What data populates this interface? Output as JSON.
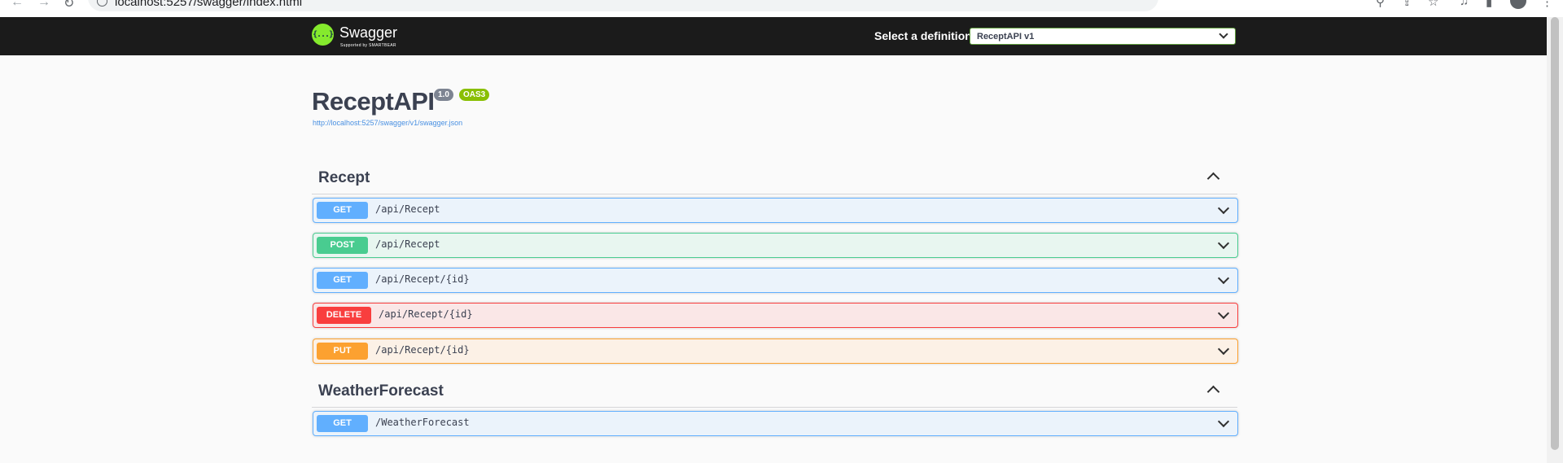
{
  "browser": {
    "url": "localhost:5257/swagger/index.html"
  },
  "topbar": {
    "brand_name": "Swagger",
    "brand_mark": "{...}",
    "brand_sub": "Supported by SMARTBEAR",
    "definition_label": "Select a definition",
    "definition_selected": "ReceptAPI v1"
  },
  "info": {
    "title": "ReceptAPI",
    "version": "1.0",
    "oas": "OAS3",
    "spec_url": "http://localhost:5257/swagger/v1/swagger.json"
  },
  "tags": [
    {
      "name": "Recept",
      "expanded": true,
      "operations": [
        {
          "method": "GET",
          "path": "/api/Recept"
        },
        {
          "method": "POST",
          "path": "/api/Recept"
        },
        {
          "method": "GET",
          "path": "/api/Recept/{id}"
        },
        {
          "method": "DELETE",
          "path": "/api/Recept/{id}"
        },
        {
          "method": "PUT",
          "path": "/api/Recept/{id}"
        }
      ]
    },
    {
      "name": "WeatherForecast",
      "expanded": true,
      "operations": [
        {
          "method": "GET",
          "path": "/WeatherForecast"
        }
      ]
    }
  ],
  "colors": {
    "get": "#61affe",
    "post": "#49cc90",
    "delete": "#f93e3e",
    "put": "#fca130",
    "topbar_bg": "#1b1b1b",
    "logo_green": "#85ea2d"
  },
  "icons": {
    "back": "arrow-left-icon",
    "forward": "arrow-right-icon",
    "reload": "reload-icon",
    "site_info": "info-icon",
    "zoom": "zoom-icon",
    "share": "share-icon",
    "bookmark": "star-icon",
    "media": "media-icon",
    "sidepanel": "side-panel-icon",
    "profile": "profile-icon",
    "menu": "kebab-menu-icon",
    "tag_toggle": "chevron-up-icon",
    "operation_toggle": "chevron-down-icon"
  }
}
